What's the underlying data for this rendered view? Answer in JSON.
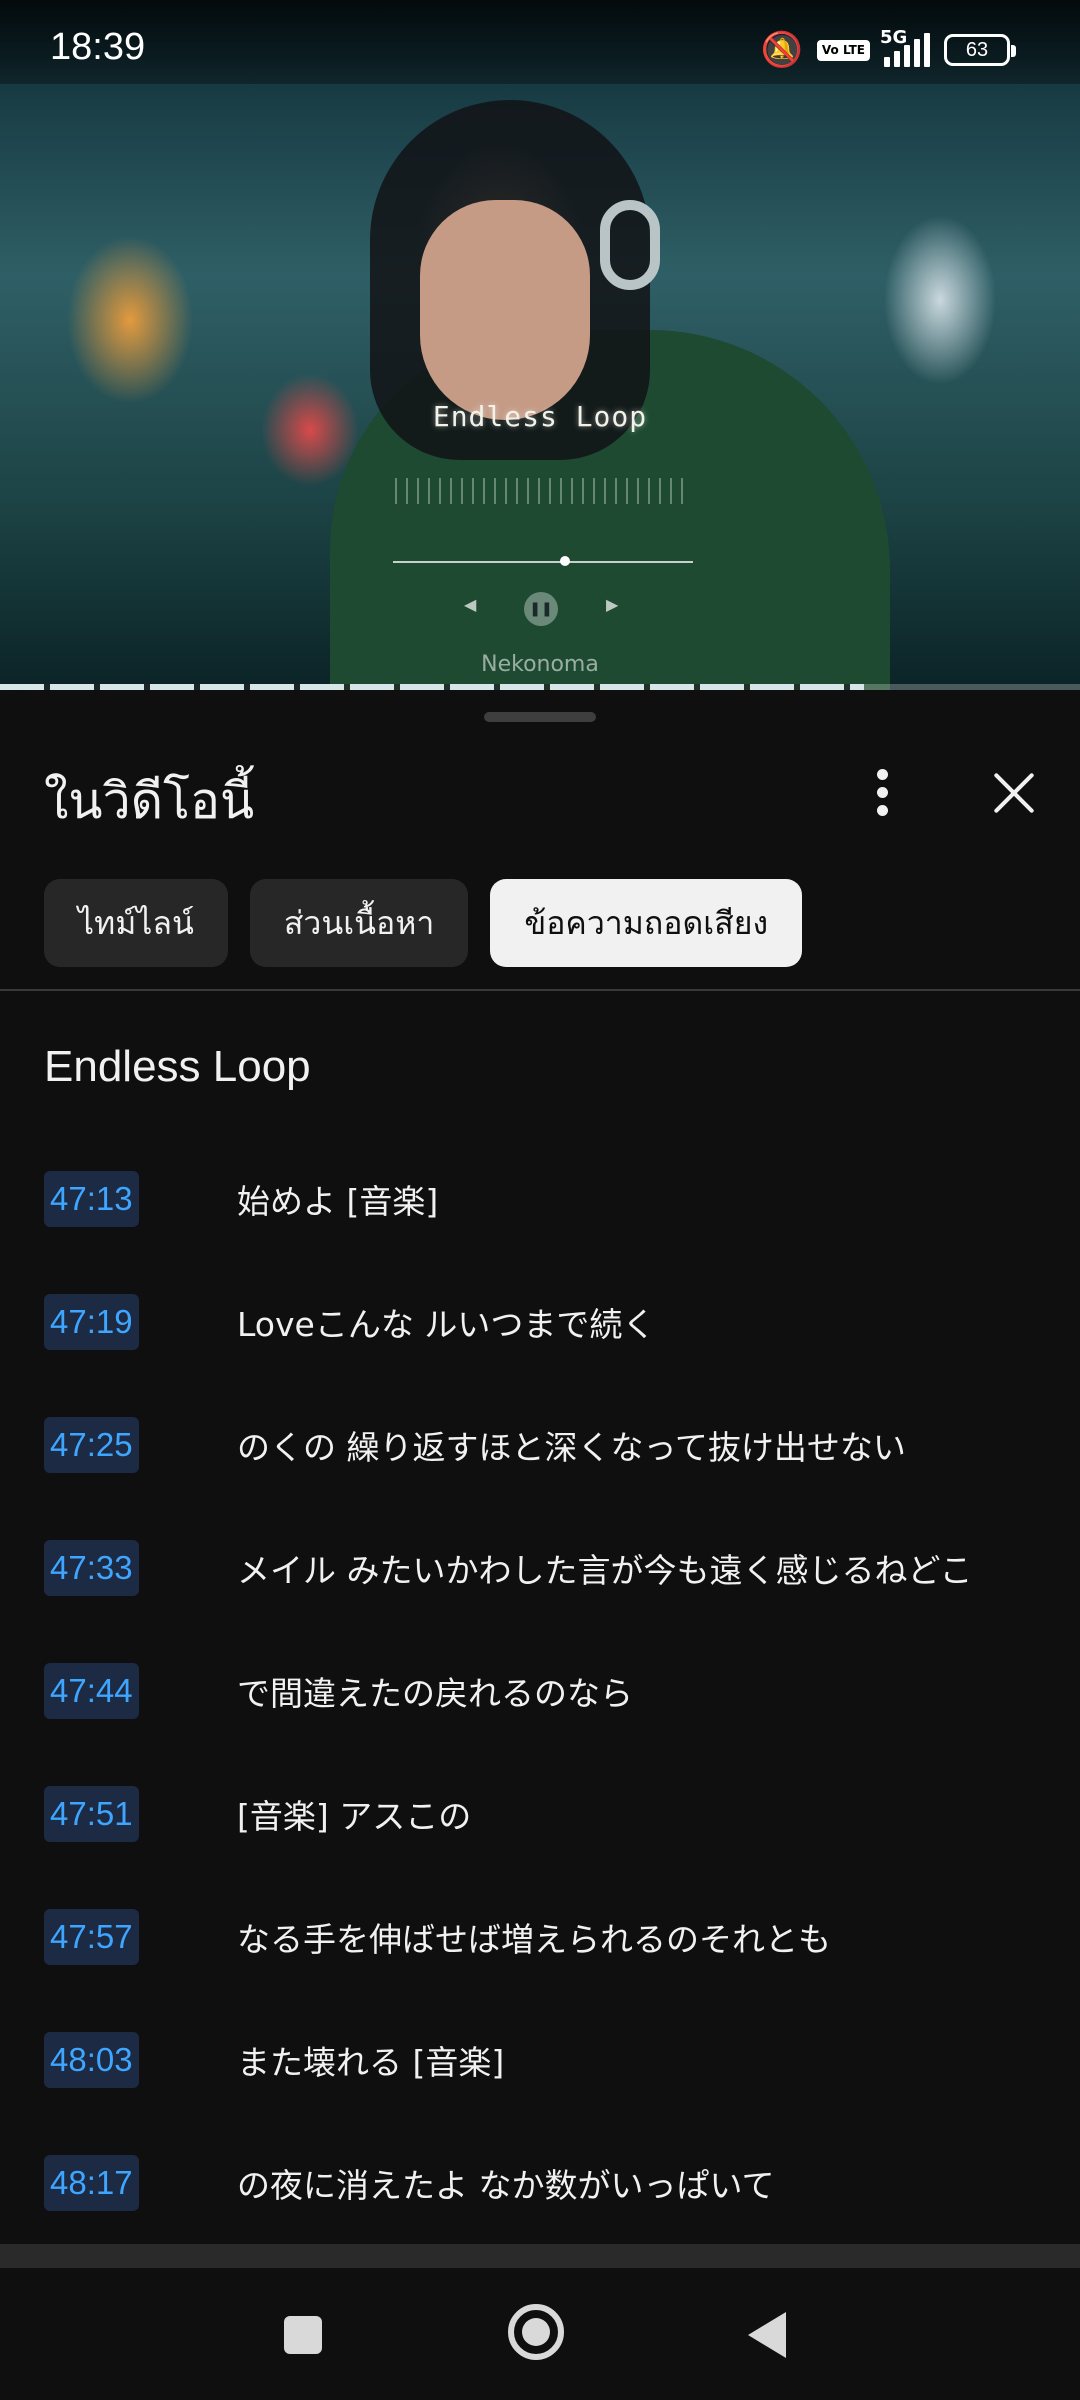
{
  "status_bar": {
    "time": "18:39",
    "volte": "Vo LTE",
    "network": "5G",
    "battery": "63"
  },
  "video": {
    "overlay_title": "Endless Loop",
    "channel_watermark": "Nekonoma",
    "progress_fraction": 0.8
  },
  "panel": {
    "title": "ในวิดีโอนี้",
    "chips": [
      {
        "label": "ไทม์ไลน์",
        "active": false
      },
      {
        "label": "ส่วนเนื้อหา",
        "active": false
      },
      {
        "label": "ข้อความถอดเสียง",
        "active": true
      }
    ],
    "section_title": "Endless Loop",
    "transcript": [
      {
        "time": "47:13",
        "text": "始めよ [音楽]"
      },
      {
        "time": "47:19",
        "text": "Loveこんな ルいつまで続く"
      },
      {
        "time": "47:25",
        "text": "のくの 繰り返すほと深くなって抜け出せない"
      },
      {
        "time": "47:33",
        "text": "メイル みたいかわした言が今も遠く感じるねどこ"
      },
      {
        "time": "47:44",
        "text": "で間違えたの戻れるのなら"
      },
      {
        "time": "47:51",
        "text": "[音楽] アスこの"
      },
      {
        "time": "47:57",
        "text": "なる手を伸ばせば増えられるのそれとも"
      },
      {
        "time": "48:03",
        "text": "また壊れる [音楽]"
      },
      {
        "time": "48:17",
        "text": "の夜に消えたよ なか数がいっぱいて"
      }
    ]
  },
  "colors": {
    "background": "#0f0f0f",
    "timestamp_text": "#3ea6ff",
    "timestamp_bg": "#1c2a44",
    "chip_bg": "#272727",
    "chip_active_bg": "#f1f1f1"
  }
}
